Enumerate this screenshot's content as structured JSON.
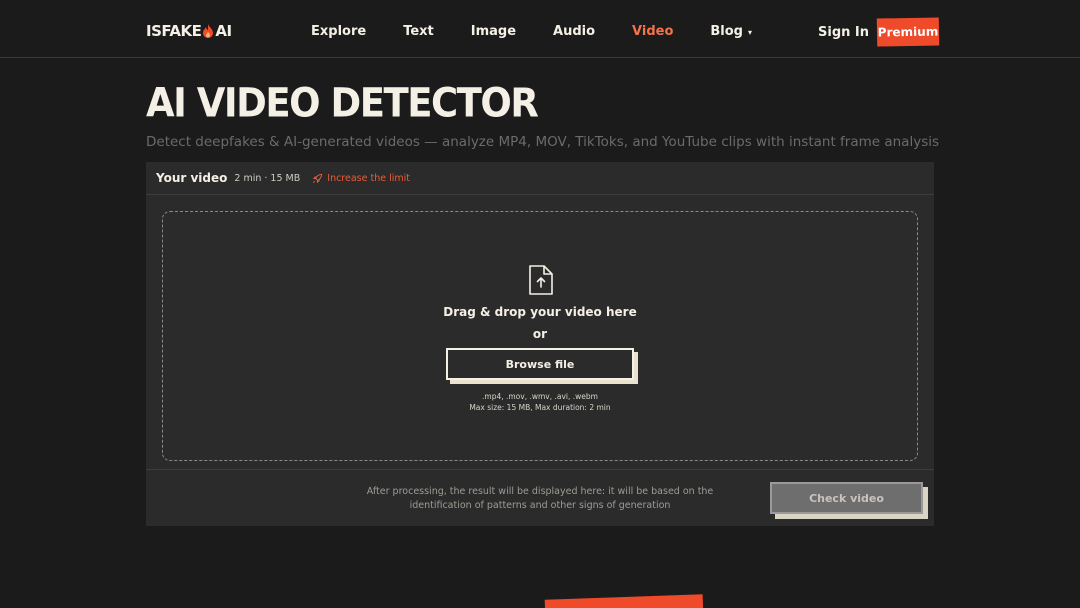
{
  "header": {
    "logo_left": "ISFAKE",
    "logo_right": "AI",
    "nav": [
      {
        "label": "Explore"
      },
      {
        "label": "Text"
      },
      {
        "label": "Image"
      },
      {
        "label": "Audio"
      },
      {
        "label": "Video",
        "active": true
      },
      {
        "label": "Blog",
        "caret": "▾"
      }
    ],
    "sign_in": "Sign In",
    "premium": "Premium"
  },
  "page": {
    "title": "AI VIDEO DETECTOR",
    "subtitle": "Detect deepfakes & AI-generated videos — analyze MP4, MOV, TikToks, and YouTube clips with instant frame analysis"
  },
  "panel": {
    "label": "Your video",
    "limits": "2 min · 15 MB",
    "increase": "Increase the limit",
    "dropzone": {
      "icon": "file-upload-icon",
      "main": "Drag & drop your video here",
      "or": "or",
      "browse": "Browse file",
      "formats": ".mp4, .mov, .wmv, .avi, .webm",
      "max": "Max size: 15 MB, Max duration: 2 min"
    },
    "footer_text": "After processing, the result will be displayed here: it will be based on the identification of patterns and other signs of generation",
    "check_button": "Check video"
  },
  "colors": {
    "background": "#1b1b1b",
    "panel": "#2b2b2b",
    "accent": "#ef4a2a",
    "active_nav": "#f5734a",
    "text": "#f4f0e6"
  }
}
